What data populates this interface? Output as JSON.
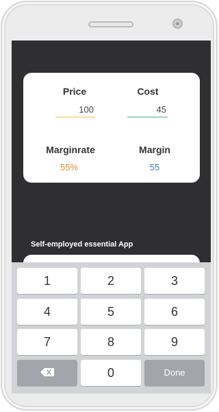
{
  "card": {
    "price_label": "Price",
    "cost_label": "Cost",
    "price_value": "100",
    "cost_value": "45",
    "marginrate_label": "Marginrate",
    "margin_label": "Margin",
    "marginrate_value": "55%",
    "margin_value": "55"
  },
  "promo": {
    "text": "Self-employed essential App"
  },
  "keyboard": {
    "keys": [
      "1",
      "2",
      "3",
      "4",
      "5",
      "6",
      "7",
      "8",
      "9"
    ],
    "zero": "0",
    "done": "Done",
    "backspace_icon": "backspace-icon"
  },
  "colors": {
    "screen_bg": "#2f2e31",
    "price_underline": "#f2c14e",
    "cost_underline": "#4aa89a",
    "marginrate_text": "#e0892a",
    "margin_text": "#2c7fc6"
  }
}
